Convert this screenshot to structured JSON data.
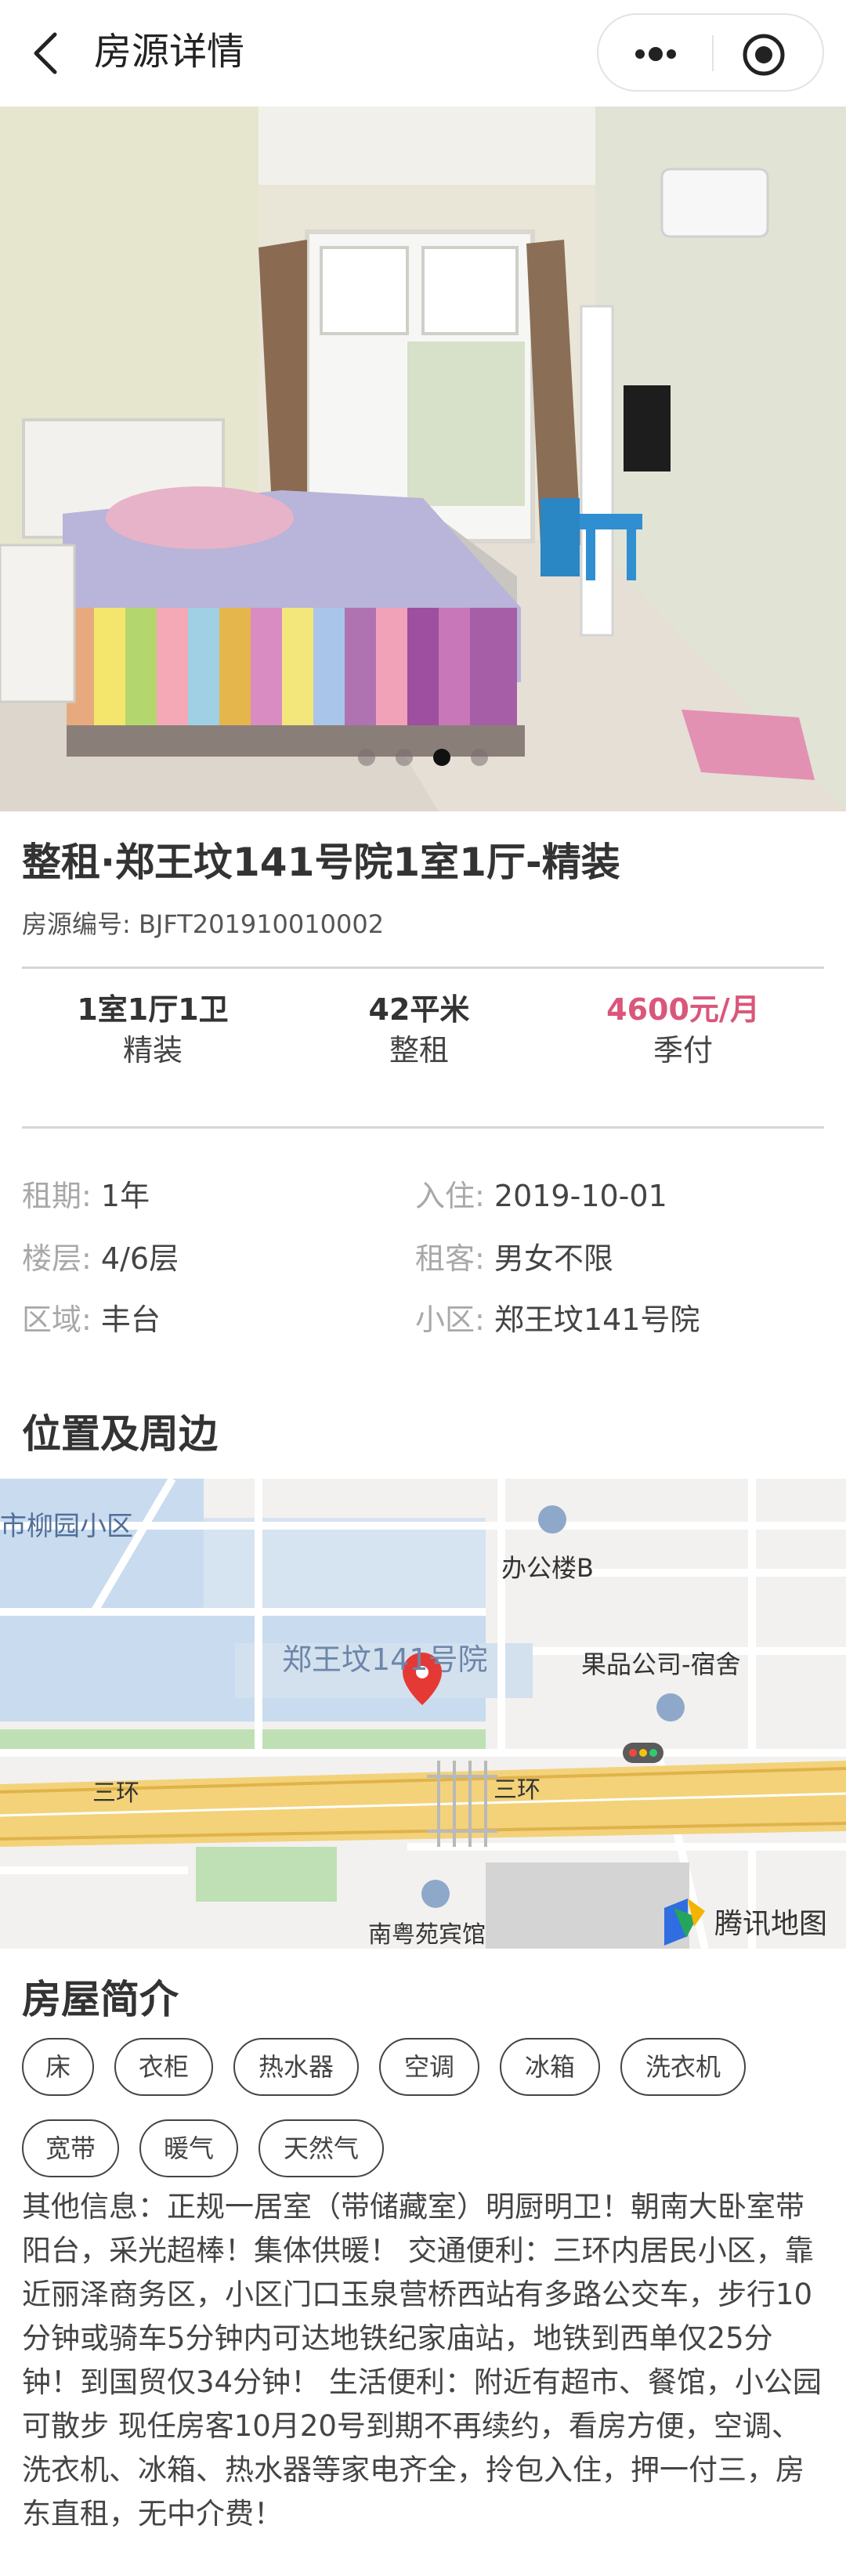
{
  "header": {
    "title": "房源详情"
  },
  "gallery": {
    "total": 4,
    "active_index": 2
  },
  "listing": {
    "title": "整租·郑王坟141号院1室1厅-精装",
    "code_label": "房源编号: ",
    "code_value": "BJFT201910010002"
  },
  "stats": [
    {
      "main": "1室1厅1卫",
      "sub": "精装"
    },
    {
      "main": "42平米",
      "sub": "整租"
    },
    {
      "main": "4600元/月",
      "sub": "季付"
    }
  ],
  "details": {
    "lease_label": "租期:",
    "lease_value": "1年",
    "movein_label": "入住:",
    "movein_value": "2019-10-01",
    "floor_label": "楼层:",
    "floor_value": "4/6层",
    "tenant_label": "租客:",
    "tenant_value": "男女不限",
    "area_label": "区域:",
    "area_value": "丰台",
    "community_label": "小区:",
    "community_value": "郑王坟141号院"
  },
  "location": {
    "section_title": "位置及周边",
    "map_labels": {
      "top_left": "市柳园小区",
      "office": "办公楼B",
      "compound": "郑王坟141号院",
      "fruit": "果品公司-宿舍",
      "ring_left": "三环",
      "ring_right": "三环",
      "hotel": "南粤苑宾馆",
      "provider": "腾讯地图"
    }
  },
  "intro": {
    "section_title": "房屋简介",
    "tags": [
      "床",
      "衣柜",
      "热水器",
      "空调",
      "冰箱",
      "洗衣机",
      "宽带",
      "暖气",
      "天然气"
    ],
    "description": "其他信息：正规一居室（带储藏室）明厨明卫！朝南大卧室带阳台，采光超棒！集体供暖！ 交通便利：三环内居民小区，靠近丽泽商务区，小区门口玉泉营桥西站有多路公交车，步行10分钟或骑车5分钟内可达地铁纪家庙站，地铁到西单仅25分钟！到国贸仅34分钟！ 生活便利：附近有超市、餐馆，小公园可散步 现任房客10月20号到期不再续约，看房方便，空调、洗衣机、冰箱、热水器等家电齐全，拎包入住，押一付三，房东直租，无中介费！"
  },
  "colors": {
    "price": "#d9577a",
    "accent_marker": "#e53935"
  }
}
